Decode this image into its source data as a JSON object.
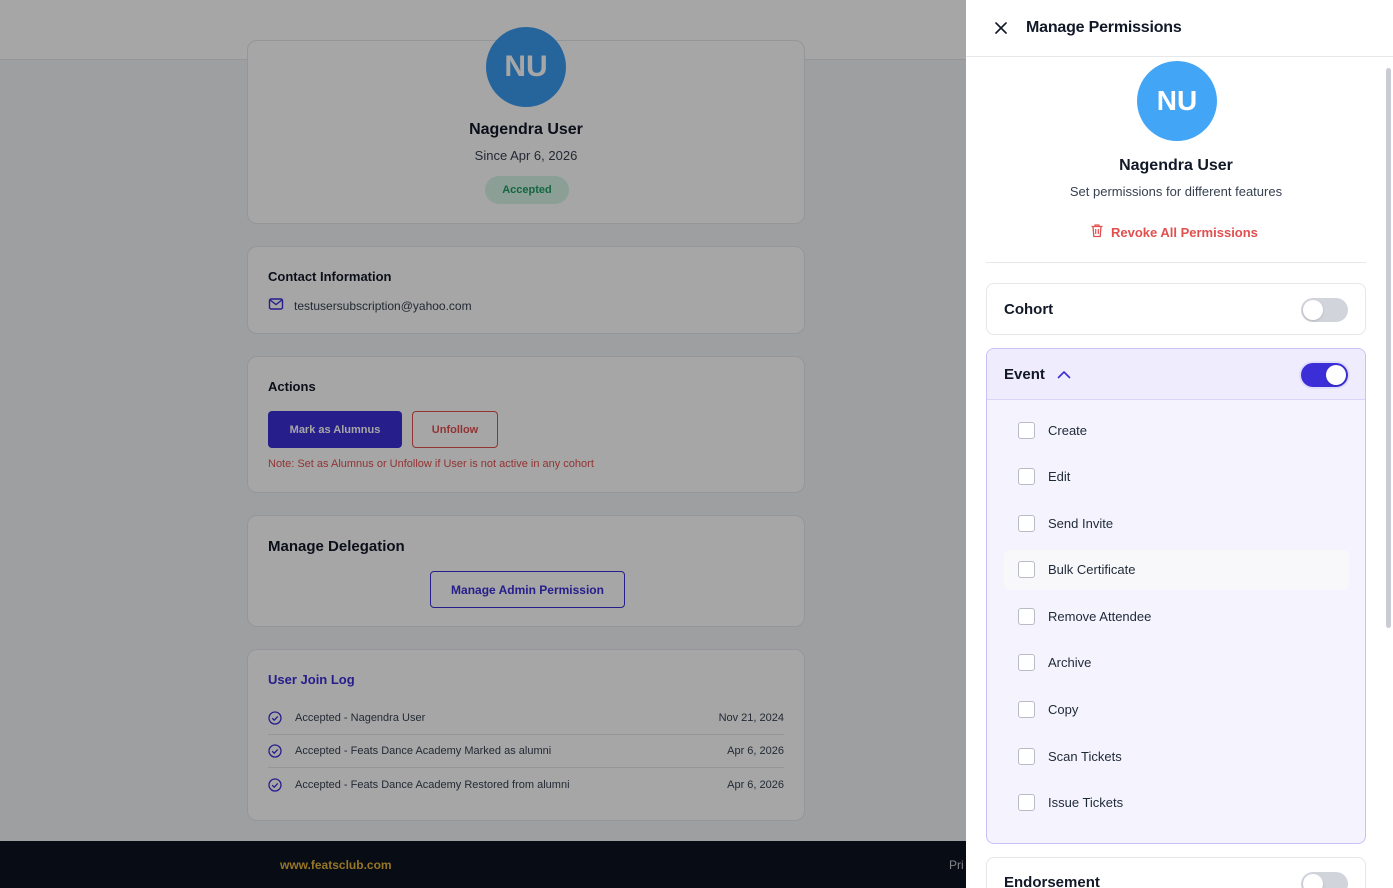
{
  "background": {
    "profile": {
      "avatar_initials": "NU",
      "name": "Nagendra User",
      "since": "Since Apr 6, 2026",
      "status_badge": "Accepted"
    },
    "contact": {
      "title": "Contact Information",
      "email": "testusersubscription@yahoo.com"
    },
    "actions": {
      "title": "Actions",
      "mark_alumnus_label": "Mark as Alumnus",
      "unfollow_label": "Unfollow",
      "note": "Note: Set as Alumnus or Unfollow if User is not active in any cohort"
    },
    "delegation": {
      "title": "Manage Delegation",
      "button_label": "Manage Admin Permission"
    },
    "join_log": {
      "title": "User Join Log",
      "entries": [
        {
          "text": "Accepted - Nagendra User",
          "date": "Nov 21, 2024"
        },
        {
          "text": "Accepted - Feats Dance Academy Marked as alumni",
          "date": "Apr 6, 2026"
        },
        {
          "text": "Accepted - Feats Dance Academy Restored from alumni",
          "date": "Apr 6, 2026"
        }
      ]
    },
    "footer": {
      "link": "www.featsclub.com",
      "right_text": "Pri"
    }
  },
  "drawer": {
    "title": "Manage Permissions",
    "avatar_initials": "NU",
    "user_name": "Nagendra User",
    "subtitle": "Set permissions for different features",
    "revoke_label": "Revoke All Permissions",
    "sections": {
      "cohort": {
        "label": "Cohort",
        "enabled": false
      },
      "event": {
        "label": "Event",
        "enabled": true,
        "expanded": true,
        "options": [
          "Create",
          "Edit",
          "Send Invite",
          "Bulk Certificate",
          "Remove Attendee",
          "Archive",
          "Copy",
          "Scan Tickets",
          "Issue Tickets"
        ]
      },
      "endorsement": {
        "label": "Endorsement",
        "enabled": false
      }
    }
  },
  "colors": {
    "accent": "#3b2ed6",
    "danger": "#e0504f",
    "avatar": "#42a5f5",
    "success_bg": "#d6f5e6",
    "footer_bg": "#0d1321",
    "footer_link": "#e6b43a"
  },
  "icons": [
    "close-icon",
    "trash-icon",
    "chevron-up-icon",
    "mail-icon",
    "check-circle-icon"
  ]
}
